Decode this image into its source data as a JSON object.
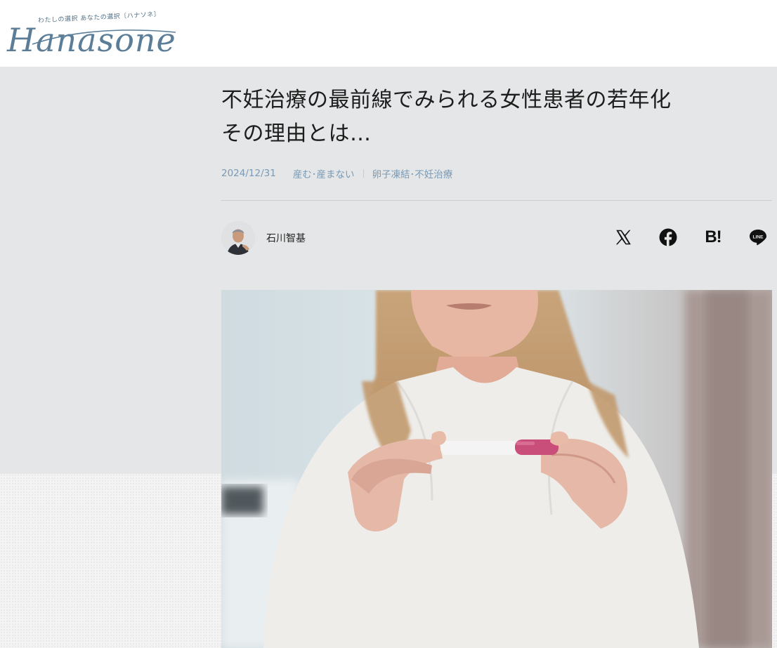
{
  "site": {
    "logo_text": "Hanasone",
    "tagline": "わたしの選択 あなたの選択〔ハナソネ〕"
  },
  "article": {
    "title_line1": "不妊治療の最前線でみられる女性患者の若年化",
    "title_line2": "その理由とは…",
    "date": "2024/12/31",
    "categories": [
      "産む･産まない",
      "卵子凍結･不妊治療"
    ],
    "author": "石川智基"
  },
  "share": {
    "x_icon": "x-icon",
    "facebook_icon": "facebook-icon",
    "hatena_label": "B!",
    "line_label": "LINE"
  },
  "colors": {
    "logo": "#5b7d97",
    "meta": "#7a9ab5",
    "band": "#e4e6e7",
    "test_strip_pink": "#c94f7a"
  }
}
